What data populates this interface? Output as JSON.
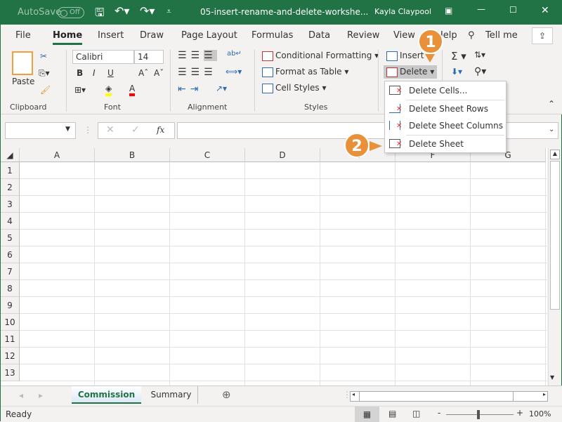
{
  "title_bar": {
    "autosave_label": "AutoSave",
    "autosave_state": "Off",
    "filename": "05-insert-rename-and-delete-workshe...",
    "user": "Kayla Claypool",
    "icons": [
      "save-icon",
      "undo-icon",
      "redo-icon",
      "customize-qat-icon",
      "ribbon-display-icon",
      "minimize-icon",
      "maximize-icon",
      "close-icon"
    ]
  },
  "menu_tabs": [
    "File",
    "Home",
    "Insert",
    "Draw",
    "Page Layout",
    "Formulas",
    "Data",
    "Review",
    "View",
    "Help"
  ],
  "active_tab": "Home",
  "tell_me": "Tell me",
  "ribbon": {
    "clipboard": {
      "label": "Clipboard",
      "paste": "Paste"
    },
    "font": {
      "label": "Font",
      "font_name": "Calibri",
      "font_size": "14",
      "bold": "B",
      "italic": "I",
      "underline": "U",
      "grow": "Aˆ",
      "shrink": "Aˇ",
      "fill_color": "#ffff00",
      "font_color": "#ff0000"
    },
    "alignment": {
      "label": "Alignment"
    },
    "styles": {
      "label": "Styles",
      "conditional": "Conditional Formatting",
      "format_table": "Format as Table",
      "cell_styles": "Cell Styles"
    },
    "cells": {
      "insert": "Insert",
      "delete": "Delete"
    }
  },
  "delete_menu": [
    "Delete Cells...",
    "Delete Sheet Rows",
    "Delete Sheet Columns",
    "Delete Sheet"
  ],
  "callouts": [
    "1",
    "2"
  ],
  "formula_bar": {
    "name_box": "",
    "fx": "fx",
    "formula": ""
  },
  "columns": [
    "A",
    "B",
    "C",
    "D",
    "E",
    "F",
    "G"
  ],
  "rows": [
    "1",
    "2",
    "3",
    "4",
    "5",
    "6",
    "7",
    "8",
    "9",
    "10",
    "11",
    "12",
    "13"
  ],
  "sheets": [
    "Commission",
    "Summary"
  ],
  "active_sheet": "Commission",
  "status": {
    "text": "Ready",
    "zoom": "100%"
  },
  "colors": {
    "accent": "#217346",
    "callout": "#e8913a"
  }
}
